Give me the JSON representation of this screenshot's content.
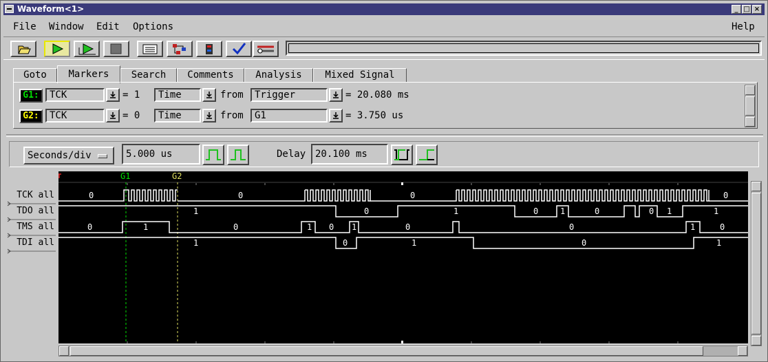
{
  "window": {
    "title": "Waveform<1>"
  },
  "menu": {
    "items": [
      "File",
      "Window",
      "Edit",
      "Options"
    ],
    "help": "Help"
  },
  "toolbar": {
    "buttons": [
      "open-folder-icon",
      "run-icon",
      "run-repetitive-icon",
      "stop-icon",
      "listing-icon",
      "network-icon",
      "probe-icon",
      "check-icon",
      "tools-icon"
    ],
    "message": ""
  },
  "tabs": [
    "Goto",
    "Markers",
    "Search",
    "Comments",
    "Analysis",
    "Mixed Signal"
  ],
  "selected_tab": "Markers",
  "markers": [
    {
      "label": "G1:",
      "color": "#00e000",
      "signal": "TCK",
      "eq": "= 1",
      "mode": "Time",
      "from_label": "from",
      "ref": "Trigger",
      "result": "= 20.080 ms"
    },
    {
      "label": "G2:",
      "color": "#ffff00",
      "signal": "TCK",
      "eq": "= 0",
      "mode": "Time",
      "from_label": "from",
      "ref": "G1",
      "result": "= 3.750 us"
    }
  ],
  "timebase": {
    "mode": "Seconds/div",
    "value": "5.000 us",
    "delay_label": "Delay",
    "delay": "20.100 ms"
  },
  "waveform": {
    "marker_labels": {
      "g1": "G1",
      "g2": "G2"
    },
    "signals": [
      {
        "name": "TCK all",
        "values": [
          "0",
          "0",
          "0",
          "0"
        ]
      },
      {
        "name": "TDO all",
        "values": [
          "1",
          "0",
          "1",
          "0",
          "1",
          "0",
          "0",
          "1",
          "1"
        ]
      },
      {
        "name": "TMS all",
        "values": [
          "0",
          "1",
          "0",
          "1",
          "0",
          "1",
          "0",
          "0",
          "1",
          "0"
        ]
      },
      {
        "name": "TDI all",
        "values": [
          "1",
          "0",
          "1",
          "0",
          "1"
        ]
      }
    ]
  }
}
